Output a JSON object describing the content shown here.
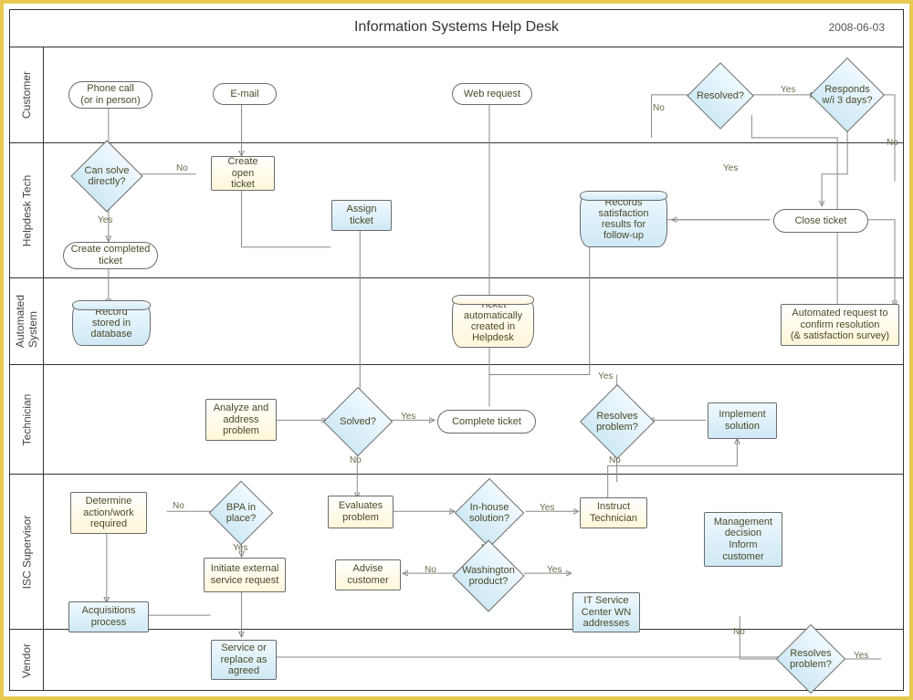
{
  "header": {
    "title": "Information Systems Help Desk",
    "date": "2008-06-03"
  },
  "lanes": {
    "customer": "Customer",
    "helpdesk_tech": "Helpdesk Tech",
    "automated_system": "Automated\nSystem",
    "technician": "Technician",
    "isc_supervisor": "ISC Supervisor",
    "vendor": "Vendor"
  },
  "nodes": {
    "phone_call": "Phone call\n(or in person)",
    "email": "E-mail",
    "web_request": "Web request",
    "resolved_q": "Resolved?",
    "responds_3days": "Responds\nw/i 3 days?",
    "can_solve_directly": "Can solve\ndirectly?",
    "create_open_ticket": "Create open\nticket",
    "assign_ticket": "Assign\nticket",
    "records_satisfaction": "Records\nsatisfaction\nresults for\nfollow-up",
    "close_ticket": "Close ticket",
    "create_completed_ticket": "Create completed\nticket",
    "record_stored_db": "Record\nstored in\ndatabase",
    "ticket_auto_created": "Ticket\nautomatically\ncreated in\nHelpdesk",
    "automated_request_confirm": "Automated request to\nconfirm resolution\n(& satisfaction survey)",
    "analyze_address": "Analyze and\naddress\nproblem",
    "solved_q": "Solved?",
    "complete_ticket": "Complete ticket",
    "resolves_problem_tech": "Resolves\nproblem?",
    "implement_solution": "Implement\nsolution",
    "determine_action": "Determine\naction/work\nrequired",
    "bpa_in_place": "BPA in\nplace?",
    "evaluates_problem": "Evaluates\nproblem",
    "in_house_solution": "In-house\nsolution?",
    "instruct_technician": "Instruct\nTechnician",
    "management_decision": "Management\ndecision\nInform\ncustomer",
    "initiate_external_sr": "Initiate external\nservice request",
    "advise_customer": "Advise\ncustomer",
    "washington_product": "Washington\nproduct?",
    "it_service_center": "IT Service\nCenter WN\naddresses",
    "acquisitions_process": "Acquisitions\nprocess",
    "service_replace": "Service or\nreplace as\nagreed",
    "resolves_problem_vendor": "Resolves\nproblem?"
  },
  "labels": {
    "yes": "Yes",
    "no": "No"
  }
}
